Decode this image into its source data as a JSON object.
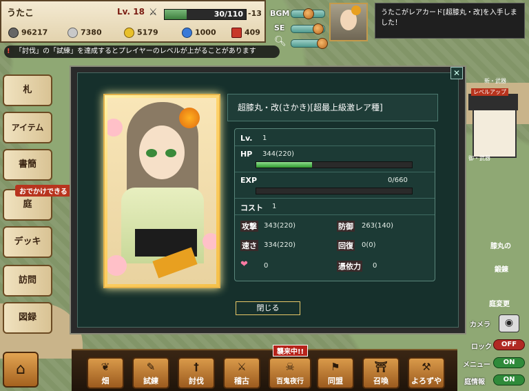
{
  "player": {
    "name": "うたこ",
    "level_label": "Lv.",
    "level": "18",
    "xp_text": "30/110",
    "xp_fraction": 0.27,
    "stamina_mod": "-13",
    "money": "96217",
    "silver": "7380",
    "gold": "5179",
    "points": "1000",
    "tickets": "409"
  },
  "settings": {
    "bgm_label": "BGM",
    "se_label": "SE",
    "zoom_icon": "magnifier-icon"
  },
  "notification": {
    "text": "うたこがレアカード[超膝丸・改]を入手しました！"
  },
  "tip": {
    "text": "「討伐」の「試練」を達成するとプレイヤーのレベルが上がることがあります"
  },
  "left_menu": [
    {
      "label": "札"
    },
    {
      "label": "アイテム"
    },
    {
      "label": "書簡"
    },
    {
      "label": "庭"
    },
    {
      "label": "デッキ"
    },
    {
      "label": "訪問"
    },
    {
      "label": "図録"
    }
  ],
  "outing_badge": "おでかけできる",
  "card": {
    "title": "超膝丸・改(さかき)[超最上級激レア種]",
    "lv_label": "Lv.",
    "lv_value": "1",
    "hp_label": "HP",
    "hp_value": "344(220)",
    "hp_fraction": 0.36,
    "exp_label": "EXP",
    "exp_value": "0/660",
    "exp_fraction": 0,
    "cost_label": "コスト",
    "cost_value": "1",
    "atk_label": "攻撃",
    "atk_value": "343(220)",
    "def_label": "防御",
    "def_value": "263(140)",
    "spd_label": "速さ",
    "spd_value": "334(220)",
    "heal_label": "回復",
    "heal_value": "0(0)",
    "heart_value": "0",
    "possess_label": "憑依力",
    "possess_value": "0",
    "close_button": "閉じる"
  },
  "bottom_menu": [
    {
      "label": "畑",
      "icon": "sprout-icon"
    },
    {
      "label": "試練",
      "icon": "scroll-icon"
    },
    {
      "label": "討伐",
      "icon": "sword-icon"
    },
    {
      "label": "稽古",
      "icon": "crossed-swords-icon"
    },
    {
      "label": "百鬼夜行",
      "icon": "demon-icon"
    },
    {
      "label": "同盟",
      "icon": "flag-icon"
    },
    {
      "label": "召喚",
      "icon": "torii-icon"
    },
    {
      "label": "よろずや",
      "icon": "hammer-icon"
    }
  ],
  "raid_badge": "襲来中!!",
  "right_panel": {
    "camera_label": "カメラ",
    "lock_label": "ロック",
    "lock_state": "OFF",
    "menu_label": "メニュー",
    "menu_state": "ON",
    "garden_label": "庭情報",
    "garden_state": "ON"
  },
  "world_labels": {
    "level_match": "レベルアップ",
    "shinsei": "新・武器",
    "samurai": "御・武器",
    "house": "庭変更",
    "character_sign1": "膝丸の",
    "character_sign2": "鍛錬"
  }
}
